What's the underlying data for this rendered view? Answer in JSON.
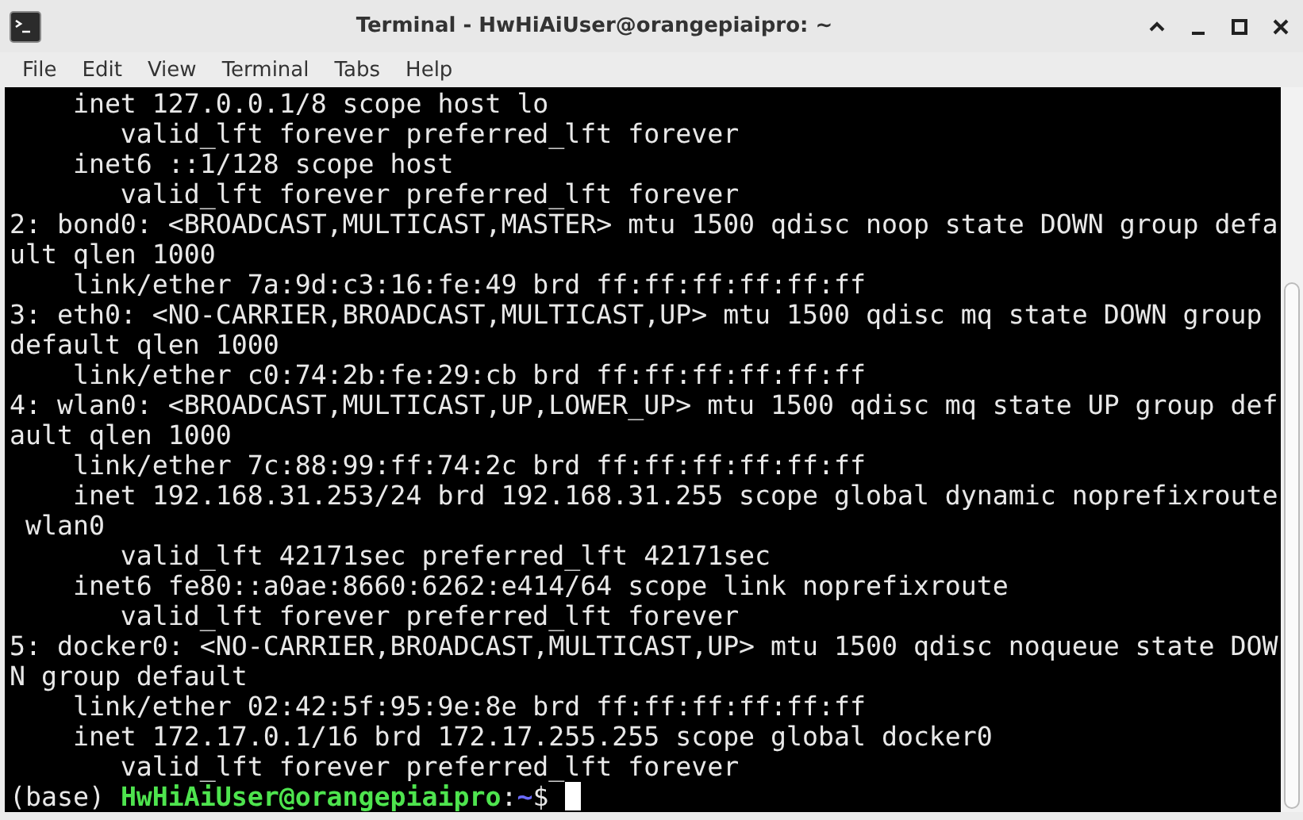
{
  "window": {
    "title": "Terminal - HwHiAiUser@orangepiaipro: ~"
  },
  "menu": [
    "File",
    "Edit",
    "View",
    "Terminal",
    "Tabs",
    "Help"
  ],
  "lines": [
    "    inet 127.0.0.1/8 scope host lo",
    "       valid_lft forever preferred_lft forever",
    "    inet6 ::1/128 scope host",
    "       valid_lft forever preferred_lft forever",
    "2: bond0: <BROADCAST,MULTICAST,MASTER> mtu 1500 qdisc noop state DOWN group defa",
    "ult qlen 1000",
    "    link/ether 7a:9d:c3:16:fe:49 brd ff:ff:ff:ff:ff:ff",
    "3: eth0: <NO-CARRIER,BROADCAST,MULTICAST,UP> mtu 1500 qdisc mq state DOWN group",
    "default qlen 1000",
    "    link/ether c0:74:2b:fe:29:cb brd ff:ff:ff:ff:ff:ff",
    "4: wlan0: <BROADCAST,MULTICAST,UP,LOWER_UP> mtu 1500 qdisc mq state UP group def",
    "ault qlen 1000",
    "    link/ether 7c:88:99:ff:74:2c brd ff:ff:ff:ff:ff:ff",
    "    inet 192.168.31.253/24 brd 192.168.31.255 scope global dynamic noprefixroute",
    " wlan0",
    "       valid_lft 42171sec preferred_lft 42171sec",
    "    inet6 fe80::a0ae:8660:6262:e414/64 scope link noprefixroute",
    "       valid_lft forever preferred_lft forever",
    "5: docker0: <NO-CARRIER,BROADCAST,MULTICAST,UP> mtu 1500 qdisc noqueue state DOW",
    "N group default",
    "    link/ether 02:42:5f:95:9e:8e brd ff:ff:ff:ff:ff:ff",
    "    inet 172.17.0.1/16 brd 172.17.255.255 scope global docker0",
    "       valid_lft forever preferred_lft forever"
  ],
  "prompt": [
    {
      "text": "(base) ",
      "kind": "plain"
    },
    {
      "text": "HwHiAiUser@orangepiaipro",
      "kind": "user"
    },
    {
      "text": ":",
      "kind": "plain"
    },
    {
      "text": "~",
      "kind": "path"
    },
    {
      "text": "$ ",
      "kind": "plain"
    }
  ]
}
